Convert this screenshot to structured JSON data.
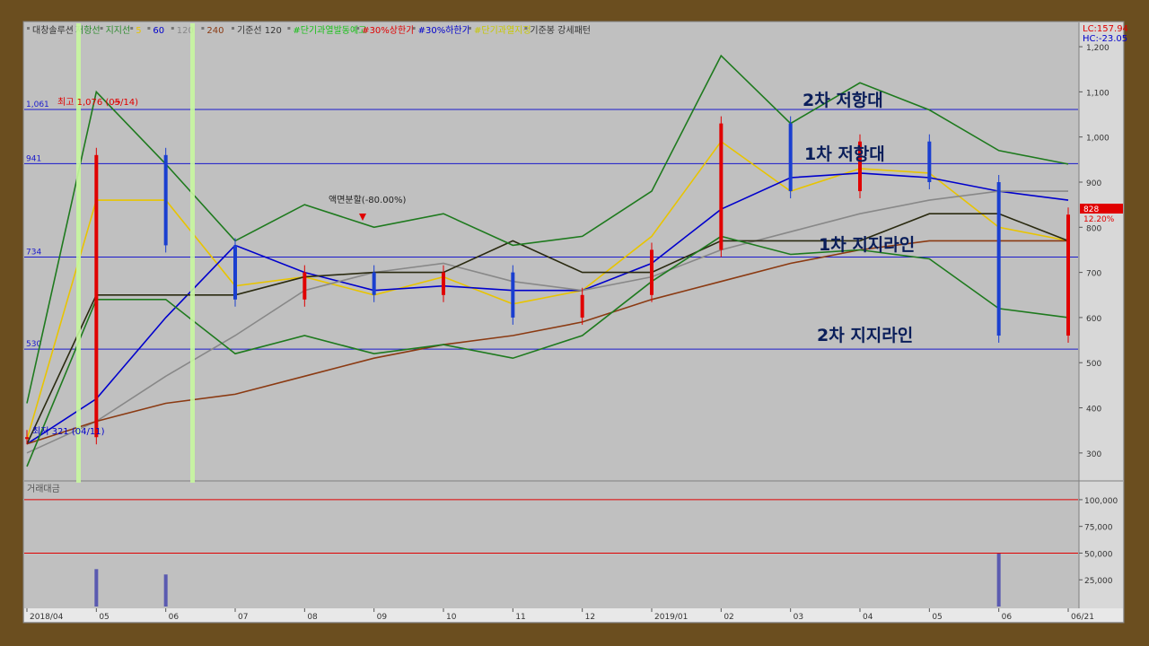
{
  "legend": [
    {
      "text": "대창솔루션",
      "color": "#333333"
    },
    {
      "text": "저항선",
      "color": "#2e8b2e"
    },
    {
      "text": "지지선",
      "color": "#2e8b2e"
    },
    {
      "text": "5",
      "color": "#e8c400"
    },
    {
      "text": "60",
      "color": "#0000cc"
    },
    {
      "text": "120",
      "color": "#888888"
    },
    {
      "text": "240",
      "color": "#8b3a12"
    },
    {
      "text": "기준선 120",
      "color": "#333333"
    },
    {
      "text": "#단기과열발동예고",
      "color": "#18c018"
    },
    {
      "text": "#30%상한가",
      "color": "#e00000"
    },
    {
      "text": "#30%하한가",
      "color": "#0000cc"
    },
    {
      "text": "#단기과열지정",
      "color": "#c8c800"
    },
    {
      "text": "기준봉 강세패턴",
      "color": "#333333"
    }
  ],
  "top_right": {
    "lc": "LC:157.94",
    "hc": "HC:-23.05"
  },
  "price_tag": {
    "value": "828",
    "change": "12.20%"
  },
  "volume_panel_label": "거래대금",
  "annotations": {
    "resistance_2": "2차 저항대",
    "resistance_1": "1차 저항대",
    "support_1": "1차 지지라인",
    "support_2": "2차 지지라인",
    "high_marker": "최고 1,076 (05/14)",
    "low_marker": "최저 321 (04/11)",
    "split_marker": "액면분할(-80.00%)"
  },
  "chart_data": [
    {
      "type": "line",
      "title": "대창솔루션",
      "y_axis_ticks": [
        "1,200",
        "1,100",
        "1,000",
        "900",
        "800",
        "700",
        "600",
        "500",
        "400",
        "300"
      ],
      "ylim": [
        250,
        1220
      ],
      "x_axis_ticks": [
        "2018/04",
        "05",
        "06",
        "07",
        "08",
        "09",
        "10",
        "11",
        "12",
        "2019/01",
        "02",
        "03",
        "04",
        "05",
        "06",
        "06/21"
      ],
      "horizontal_levels": [
        {
          "label": "1,061",
          "value": 1061
        },
        {
          "label": "941",
          "value": 941
        },
        {
          "label": "734",
          "value": 734
        },
        {
          "label": "530",
          "value": 530
        }
      ],
      "series": [
        {
          "name": "5",
          "color": "#e8c400",
          "x": [
            "2018/04",
            "05",
            "06",
            "07",
            "08",
            "09",
            "10",
            "11",
            "12",
            "2019/01",
            "02",
            "03",
            "04",
            "05",
            "06",
            "06/21"
          ],
          "values": [
            330,
            860,
            860,
            670,
            690,
            650,
            690,
            630,
            660,
            780,
            990,
            880,
            930,
            920,
            800,
            770
          ]
        },
        {
          "name": "60",
          "color": "#0000cc",
          "x": [
            "2018/04",
            "05",
            "06",
            "07",
            "08",
            "09",
            "10",
            "11",
            "12",
            "2019/01",
            "02",
            "03",
            "04",
            "05",
            "06",
            "06/21"
          ],
          "values": [
            320,
            420,
            600,
            760,
            700,
            660,
            670,
            660,
            660,
            720,
            840,
            910,
            920,
            910,
            880,
            860
          ]
        },
        {
          "name": "120",
          "color": "#888888",
          "x": [
            "2018/04",
            "05",
            "06",
            "07",
            "08",
            "09",
            "10",
            "11",
            "12",
            "2019/01",
            "02",
            "03",
            "04",
            "05",
            "06",
            "06/21"
          ],
          "values": [
            300,
            370,
            470,
            560,
            660,
            700,
            720,
            680,
            660,
            690,
            750,
            790,
            830,
            860,
            880,
            880
          ]
        },
        {
          "name": "240",
          "color": "#8b3a12",
          "x": [
            "2018/04",
            "05",
            "06",
            "07",
            "08",
            "09",
            "10",
            "11",
            "12",
            "2019/01",
            "02",
            "03",
            "04",
            "05",
            "06",
            "06/21"
          ],
          "values": [
            320,
            370,
            410,
            430,
            470,
            510,
            540,
            560,
            590,
            640,
            680,
            720,
            750,
            770,
            770,
            770
          ]
        },
        {
          "name": "기준선 120",
          "color": "#2a2a10",
          "x": [
            "2018/04",
            "05",
            "06",
            "07",
            "08",
            "09",
            "10",
            "11",
            "12",
            "2019/01",
            "02",
            "03",
            "04",
            "05",
            "06",
            "06/21"
          ],
          "values": [
            320,
            650,
            650,
            650,
            690,
            700,
            700,
            770,
            700,
            700,
            770,
            770,
            770,
            830,
            830,
            770
          ]
        },
        {
          "name": "저항선",
          "color": "#1e7a1e",
          "x": [
            "2018/04",
            "05",
            "06",
            "07",
            "08",
            "09",
            "10",
            "11",
            "12",
            "2019/01",
            "02",
            "03",
            "04",
            "05",
            "06",
            "06/21"
          ],
          "values": [
            410,
            1100,
            940,
            770,
            850,
            800,
            830,
            760,
            780,
            880,
            1180,
            1030,
            1120,
            1060,
            970,
            940
          ]
        },
        {
          "name": "지지선",
          "color": "#1e7a1e",
          "x": [
            "2018/04",
            "05",
            "06",
            "07",
            "08",
            "09",
            "10",
            "11",
            "12",
            "2019/01",
            "02",
            "03",
            "04",
            "05",
            "06",
            "06/21"
          ],
          "values": [
            270,
            640,
            640,
            520,
            560,
            520,
            540,
            510,
            560,
            680,
            780,
            740,
            750,
            730,
            620,
            600
          ]
        }
      ],
      "close": {
        "x": [
          "2018/04",
          "05",
          "06",
          "07",
          "08",
          "09",
          "10",
          "11",
          "12",
          "2019/01",
          "02",
          "03",
          "04",
          "05",
          "06",
          "06/21"
        ],
        "values": [
          335,
          960,
          760,
          640,
          700,
          650,
          700,
          600,
          650,
          750,
          1030,
          880,
          990,
          900,
          560,
          828
        ]
      }
    },
    {
      "type": "bar",
      "title": "거래대금",
      "y_axis_ticks": [
        "100,000",
        "75,000",
        "50,000",
        "25,000"
      ],
      "ylim": [
        0,
        110000
      ],
      "horizontal_levels": [
        {
          "value": 100000
        },
        {
          "value": 50000
        }
      ],
      "categories": [
        "05",
        "06",
        "2019/06"
      ],
      "values": [
        35000,
        30000,
        50000
      ]
    }
  ]
}
